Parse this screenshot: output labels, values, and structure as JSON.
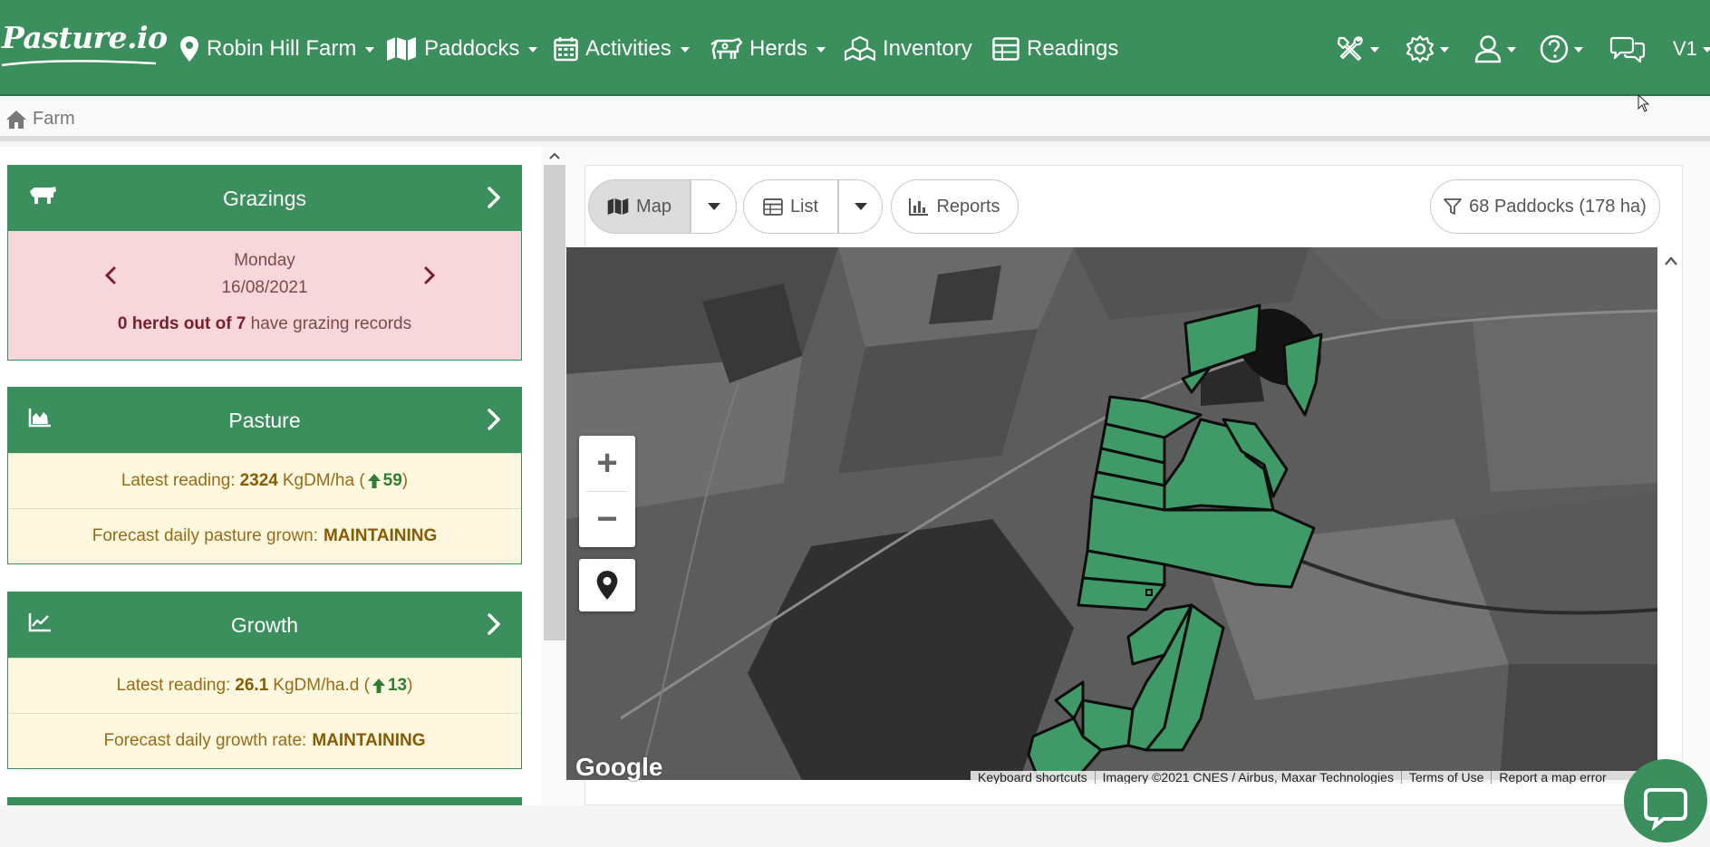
{
  "nav": {
    "brand": "Pasture.io",
    "farm": "Robin Hill Farm",
    "paddocks": "Paddocks",
    "activities": "Activities",
    "herds": "Herds",
    "inventory": "Inventory",
    "readings": "Readings",
    "version": "V1",
    "icons": [
      "tools-icon",
      "gear-icon",
      "user-icon",
      "help-icon",
      "chat-icon"
    ]
  },
  "breadcrumb": {
    "home": "Farm"
  },
  "grazings": {
    "title": "Grazings",
    "day": "Monday",
    "date": "16/08/2021",
    "herds_with_records": "0 herds out of 7",
    "summary_suffix": "have grazing records"
  },
  "pasture": {
    "title": "Pasture",
    "latest_label": "Latest reading:",
    "latest_value": "2324",
    "latest_unit": "KgDM/ha (",
    "latest_change": "59",
    "close_paren": ")",
    "forecast_label": "Forecast daily pasture grown:",
    "forecast_value": "MAINTAINING"
  },
  "growth": {
    "title": "Growth",
    "latest_label": "Latest reading:",
    "latest_value": "26.1",
    "latest_unit": "KgDM/ha.d (",
    "latest_change": "13",
    "close_paren": ")",
    "forecast_label": "Forecast daily growth rate:",
    "forecast_value": "MAINTAINING"
  },
  "toolbar": {
    "map": "Map",
    "list": "List",
    "reports": "Reports",
    "paddock_filter": "68 Paddocks (178 ha)"
  },
  "map": {
    "zoom_in": "+",
    "zoom_out": "−",
    "google": "Google",
    "attribution": [
      "Keyboard shortcuts",
      "Imagery ©2021 CNES / Airbus, Maxar Technologies",
      "Terms of Use",
      "Report a map error"
    ]
  },
  "colors": {
    "brand_green": "#3a8f5c",
    "alert_pink": "#f8d7da",
    "cream": "#fff8e1",
    "paddock_fill": "#3f9a68"
  }
}
